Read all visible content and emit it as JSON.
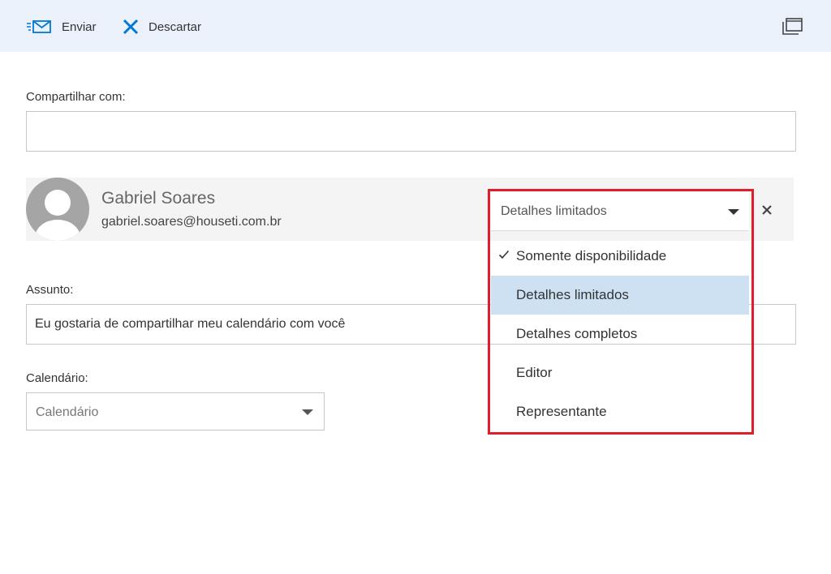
{
  "toolbar": {
    "send_label": "Enviar",
    "discard_label": "Descartar",
    "send_icon": "send-mail-icon",
    "discard_icon": "close-x-icon",
    "popout_icon": "popout-window-icon",
    "accent_color": "#0078d4",
    "background_color": "#eaf1fa"
  },
  "share_with": {
    "label": "Compartilhar com:",
    "value": ""
  },
  "recipient": {
    "name": "Gabriel Soares",
    "email": "gabriel.soares@houseti.com.br",
    "avatar_icon": "default-person-avatar",
    "permission": {
      "selected_value": "Detalhes limitados",
      "options": [
        {
          "label": "Somente disponibilidade",
          "checked": true,
          "highlighted": false
        },
        {
          "label": "Detalhes limitados",
          "checked": false,
          "highlighted": true
        },
        {
          "label": "Detalhes completos",
          "checked": false,
          "highlighted": false
        },
        {
          "label": "Editor",
          "checked": false,
          "highlighted": false
        },
        {
          "label": "Representante",
          "checked": false,
          "highlighted": false
        }
      ],
      "highlight_border_color": "#e01e2b",
      "highlighted_option_color": "#cde1f3"
    }
  },
  "subject": {
    "label": "Assunto:",
    "value": "Eu gostaria de compartilhar meu calendário com você"
  },
  "calendar": {
    "label": "Calendário:",
    "placeholder": "Calendário"
  }
}
